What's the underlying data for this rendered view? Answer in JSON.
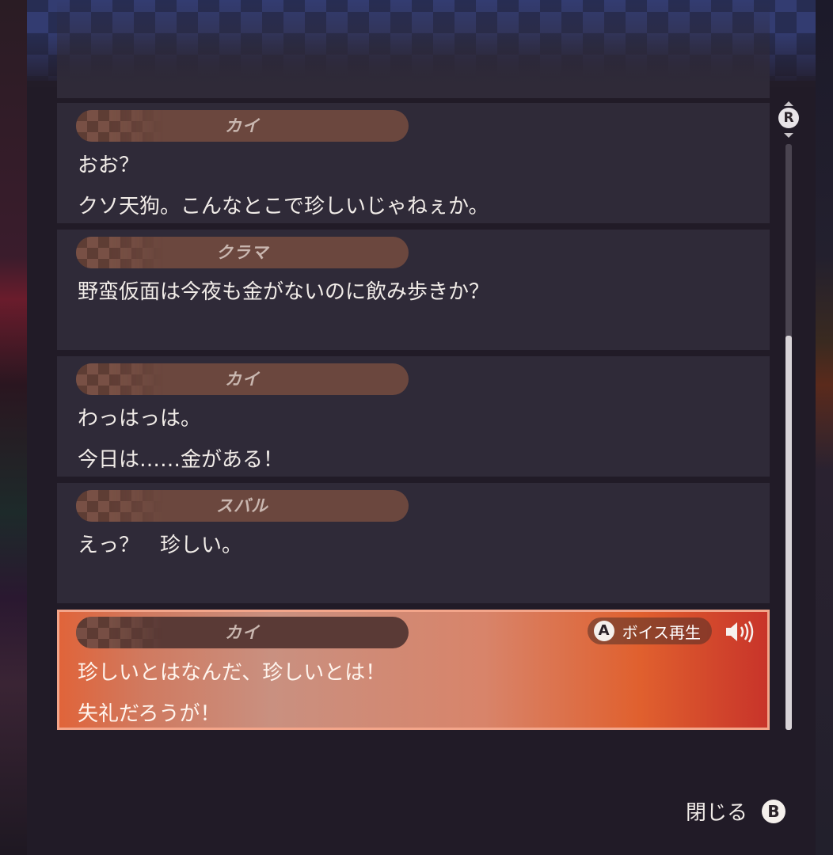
{
  "entries": [
    {
      "speaker": "カイ",
      "lines": [
        "おお？",
        "クソ天狗。こんなとこで珍しいじゃねぇか。"
      ]
    },
    {
      "speaker": "クラマ",
      "lines": [
        "野蛮仮面は今夜も金がないのに飲み歩きか？",
        ""
      ]
    },
    {
      "speaker": "カイ",
      "lines": [
        "わっはっは。",
        "今日は……金がある！"
      ]
    },
    {
      "speaker": "スバル",
      "lines": [
        "えっ？　珍しい。",
        ""
      ]
    },
    {
      "speaker": "カイ",
      "lines": [
        "珍しいとはなんだ、珍しいとは！",
        "失礼だろうが！"
      ]
    }
  ],
  "voice": {
    "button": "A",
    "label": "ボイス再生",
    "icon": "speaker-icon"
  },
  "scroll": {
    "button": "R"
  },
  "close": {
    "label": "閉じる",
    "button": "B"
  },
  "colors": {
    "active_accent": "#e0602e",
    "card_bg": "#2f2a38",
    "name_pill": "#6b473e"
  }
}
